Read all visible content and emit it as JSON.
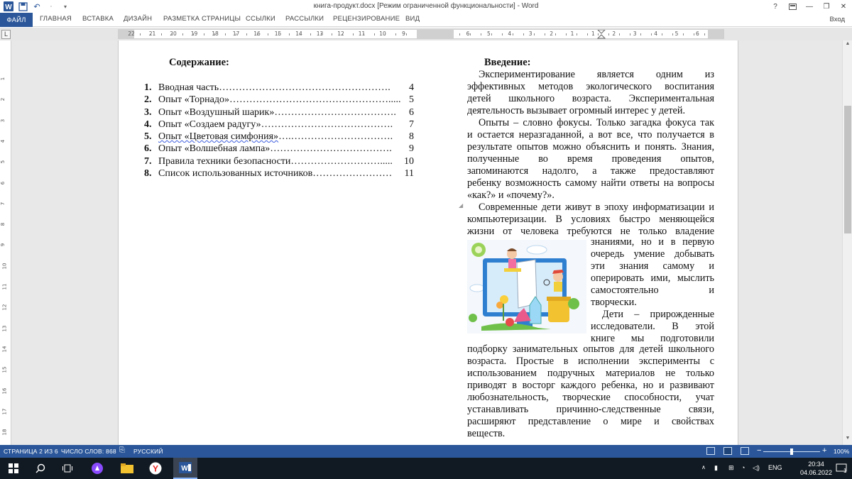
{
  "window": {
    "title": "книга-продукт.docx [Режим ограниченной функциональности] - Word",
    "help": "?",
    "signin": "Вход"
  },
  "ribbon": {
    "tabs": [
      "ФАЙЛ",
      "ГЛАВНАЯ",
      "ВСТАВКА",
      "ДИЗАЙН",
      "РАЗМЕТКА СТРАНИЦЫ",
      "ССЫЛКИ",
      "РАССЫЛКИ",
      "РЕЦЕНЗИРОВАНИЕ",
      "ВИД"
    ]
  },
  "ruler": {
    "corner": "L",
    "left_numbers": [
      "22",
      "21",
      "20",
      "19",
      "18",
      "17",
      "16",
      "15",
      "14",
      "13",
      "12",
      "11",
      "10",
      "9"
    ],
    "right_numbers": [
      "6",
      "5",
      "4",
      "3",
      "2",
      "1",
      "1",
      "2",
      "3",
      "4",
      "5",
      "6"
    ],
    "vertical_numbers": [
      "1",
      "2",
      "3",
      "4",
      "5",
      "6",
      "7",
      "8",
      "9",
      "10",
      "11",
      "12",
      "13",
      "14",
      "15",
      "16",
      "17",
      "18"
    ]
  },
  "toc": {
    "title": "Содержание:",
    "items": [
      {
        "num": "1.",
        "text": "Вводная часть",
        "dots": "…………………………………………….",
        "page": "4"
      },
      {
        "num": "2.",
        "text": "Опыт «Торнадо»",
        "dots": "………………………………………….....",
        "page": "5"
      },
      {
        "num": "3.",
        "text": "Опыт «Воздушный шарик»",
        "dots": "……………………………….",
        "page": "6"
      },
      {
        "num": "4.",
        "text": "Опыт «Создаем радугу»",
        "dots": "………………………………….",
        "page": "7"
      },
      {
        "num": "5.",
        "text": "Опыт «Цветовая симфония»",
        "dots": "….………………………….",
        "page": "8"
      },
      {
        "num": "6.",
        "text": "Опыт «Волшебная лампа»",
        "dots": "……………………………….",
        "page": "9"
      },
      {
        "num": "7.",
        "text": "Правила техники безопасности",
        "dots": "……………………….....",
        "page": "10"
      },
      {
        "num": "8.",
        "text": "Список использованных источников",
        "dots": "……………………",
        "page": "11"
      }
    ]
  },
  "intro": {
    "title": "Введение:",
    "block1": [
      "Экспериментирование является одним из",
      "эффективных методов экологического воспитания",
      "детей школьного возраста. Экспериментальная",
      "деятельность вызывает огромный интерес у детей.",
      "Опыты – словно фокусы. Только загадка фокуса так",
      "и остается неразгаданной, а вот все, что получается в",
      "результате опытов можно объяснить и понять. Знания,",
      "полученные во время проведения опытов,",
      "запоминаются надолго, а также предоставляют",
      "ребенку возможность самому найти ответы на вопросы",
      "«как?» и «почему?».",
      "Современные дети живут в эпоху информатизации и",
      "компьютеризации. В условиях быстро меняющейся",
      "жизни от человека требуются не только владение"
    ],
    "wrapped": [
      "знаниями, но и в первую",
      "очередь умение добывать",
      "эти знания самому и",
      "оперировать ими, мыслить",
      "самостоятельно и",
      "творчески.",
      "Дети – прирожденные",
      "исследователи. В этой",
      "книге мы подготовили"
    ],
    "block2": [
      "подборку занимательных опытов для детей школьного",
      "возраста. Простые в исполнении эксперименты с",
      "использованием подручных материалов не только",
      "приводят в восторг каждого ребенка, но и развивают",
      "любознательность, творческие способности, учат",
      "устанавливать причинно-следственные связи,",
      "расширяют представление о мире и свойствах",
      "веществ."
    ]
  },
  "status": {
    "page": "СТРАНИЦА 2 ИЗ 6",
    "words": "ЧИСЛО СЛОВ: 868",
    "language": "РУССКИЙ",
    "zoom": "100%",
    "zoom_level": 0.5
  },
  "taskbar": {
    "lang": "ENG",
    "time": "20:34",
    "date": "04.06.2022",
    "notifications": "1"
  },
  "colors": {
    "accent": "#2b579a",
    "taskbar": "#111a22"
  }
}
